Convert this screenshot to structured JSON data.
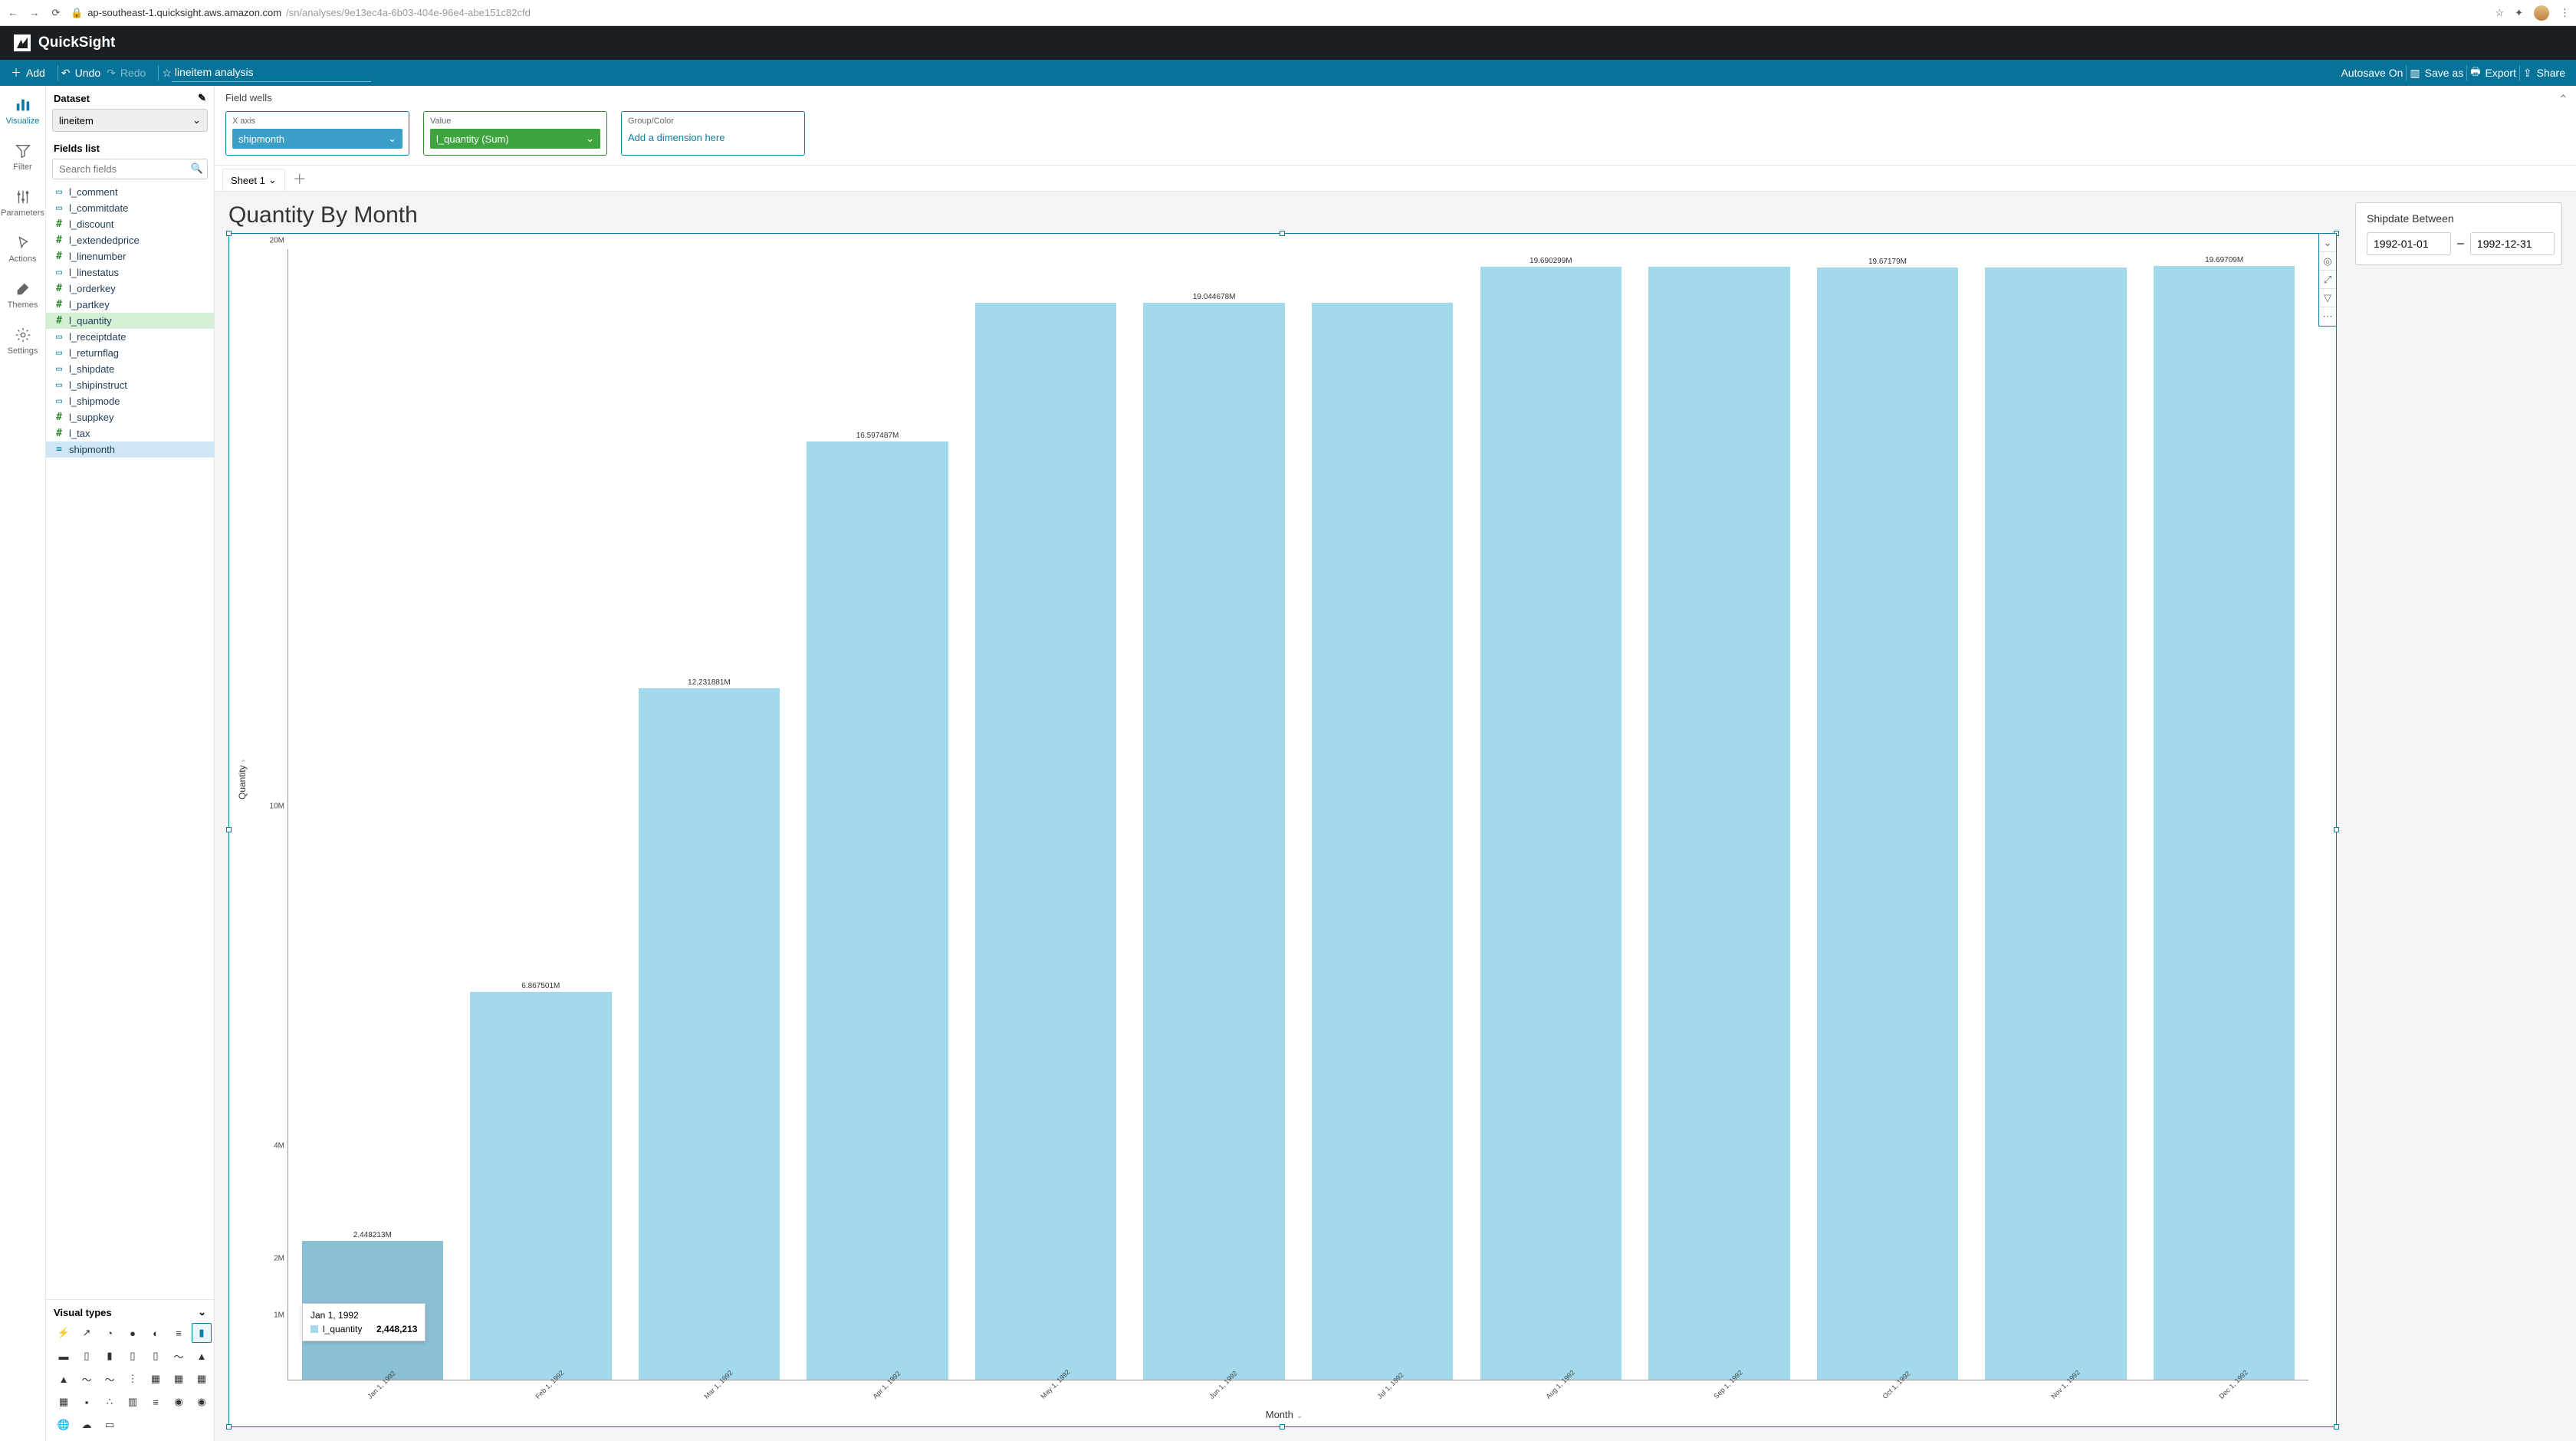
{
  "browser": {
    "url_host": "ap-southeast-1.quicksight.aws.amazon.com",
    "url_path": "/sn/analyses/9e13ec4a-6b03-404e-96e4-abe151c82cfd"
  },
  "brand": "QuickSight",
  "toolbar": {
    "add": "Add",
    "undo": "Undo",
    "redo": "Redo",
    "title": "lineitem analysis",
    "autosave": "Autosave On",
    "saveas": "Save as",
    "export": "Export",
    "share": "Share"
  },
  "rail": {
    "visualize": "Visualize",
    "filter": "Filter",
    "parameters": "Parameters",
    "actions": "Actions",
    "themes": "Themes",
    "settings": "Settings"
  },
  "dataset": {
    "label": "Dataset",
    "selected": "lineitem",
    "fields_label": "Fields list",
    "search_placeholder": "Search fields",
    "fields": [
      {
        "name": "l_comment",
        "type": "str"
      },
      {
        "name": "l_commitdate",
        "type": "date"
      },
      {
        "name": "l_discount",
        "type": "num"
      },
      {
        "name": "l_extendedprice",
        "type": "num"
      },
      {
        "name": "l_linenumber",
        "type": "num"
      },
      {
        "name": "l_linestatus",
        "type": "str"
      },
      {
        "name": "l_orderkey",
        "type": "num"
      },
      {
        "name": "l_partkey",
        "type": "num"
      },
      {
        "name": "l_quantity",
        "type": "num",
        "sel": "green"
      },
      {
        "name": "l_receiptdate",
        "type": "date"
      },
      {
        "name": "l_returnflag",
        "type": "str"
      },
      {
        "name": "l_shipdate",
        "type": "date"
      },
      {
        "name": "l_shipinstruct",
        "type": "str"
      },
      {
        "name": "l_shipmode",
        "type": "str"
      },
      {
        "name": "l_suppkey",
        "type": "num"
      },
      {
        "name": "l_tax",
        "type": "num"
      },
      {
        "name": "shipmonth",
        "type": "calc",
        "sel": "blue"
      }
    ]
  },
  "visual_types_label": "Visual types",
  "field_wells": {
    "label": "Field wells",
    "xaxis": {
      "label": "X axis",
      "chip": "shipmonth"
    },
    "value": {
      "label": "Value",
      "chip": "l_quantity (Sum)"
    },
    "group": {
      "label": "Group/Color",
      "placeholder": "Add a dimension here"
    }
  },
  "sheets": {
    "tab1": "Sheet 1"
  },
  "chart_title": "Quantity By Month",
  "filter_panel": {
    "title": "Shipdate Between",
    "from": "1992-01-01",
    "to": "1992-12-31",
    "sep": "–"
  },
  "axis": {
    "y_title": "Quantity",
    "x_title": "Month"
  },
  "tooltip": {
    "title": "Jan 1, 1992",
    "series": "l_quantity",
    "value": "2,448,213"
  },
  "chart_data": {
    "type": "bar",
    "title": "Quantity By Month",
    "xlabel": "Month",
    "ylabel": "Quantity",
    "ylim": [
      0,
      20000000
    ],
    "y_ticks": [
      {
        "v": 1000000,
        "l": "1M"
      },
      {
        "v": 2000000,
        "l": "2M"
      },
      {
        "v": 4000000,
        "l": "4M"
      },
      {
        "v": 10000000,
        "l": "10M"
      },
      {
        "v": 20000000,
        "l": "20M"
      }
    ],
    "categories": [
      "Jan 1, 1992",
      "Feb 1, 1992",
      "Mar 1, 1992",
      "Apr 1, 1992",
      "May 1, 1992",
      "Jun 1, 1992",
      "Jul 1, 1992",
      "Aug 1, 1992",
      "Sep 1, 1992",
      "Oct 1, 1992",
      "Nov 1, 1992",
      "Dec 1, 1992"
    ],
    "values": [
      2448213,
      6867501,
      12231881,
      16597487,
      19044678,
      19044678,
      19044678,
      19690299,
      19690299,
      19671790,
      19671790,
      19697090
    ],
    "data_labels": [
      "2.448213M",
      "6.867501M",
      "12.231881M",
      "16.597487M",
      "",
      "19.044678M",
      "",
      "19.690299M",
      "",
      "19.67179M",
      "",
      "19.69709M"
    ],
    "series_name": "l_quantity",
    "highlight_index": 0
  }
}
